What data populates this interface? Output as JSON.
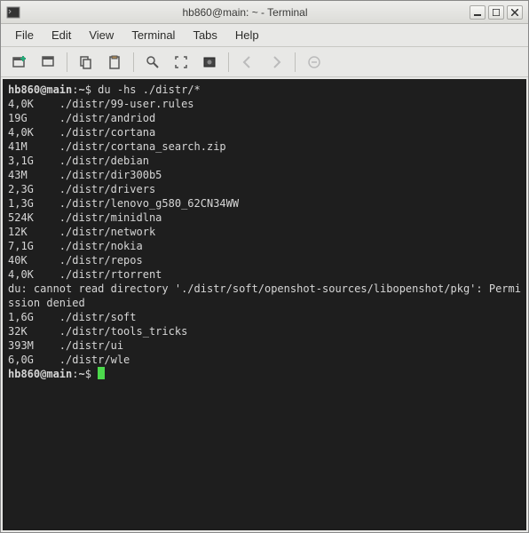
{
  "titlebar": {
    "title": "hb860@main: ~ - Terminal"
  },
  "menubar": {
    "file": "File",
    "edit": "Edit",
    "view": "View",
    "terminal": "Terminal",
    "tabs": "Tabs",
    "help": "Help"
  },
  "prompt": {
    "user_host": "hb860@main",
    "sep": ":",
    "path": "~",
    "symbol": "$"
  },
  "command": "du -hs ./distr/*",
  "output_rows": [
    {
      "size": "4,0K",
      "path": "./distr/99-user.rules"
    },
    {
      "size": "19G",
      "path": "./distr/andriod"
    },
    {
      "size": "4,0K",
      "path": "./distr/cortana"
    },
    {
      "size": "41M",
      "path": "./distr/cortana_search.zip"
    },
    {
      "size": "3,1G",
      "path": "./distr/debian"
    },
    {
      "size": "43M",
      "path": "./distr/dir300b5"
    },
    {
      "size": "2,3G",
      "path": "./distr/drivers"
    },
    {
      "size": "1,3G",
      "path": "./distr/lenovo_g580_62CN34WW"
    },
    {
      "size": "524K",
      "path": "./distr/minidlna"
    },
    {
      "size": "12K",
      "path": "./distr/network"
    },
    {
      "size": "7,1G",
      "path": "./distr/nokia"
    },
    {
      "size": "40K",
      "path": "./distr/repos"
    },
    {
      "size": "4,0K",
      "path": "./distr/rtorrent"
    }
  ],
  "error_line1": "du: cannot read directory './distr/soft/openshot-sources/libopenshot/pkg': Permi",
  "error_line2": "ssion denied",
  "output_rows2": [
    {
      "size": "1,6G",
      "path": "./distr/soft"
    },
    {
      "size": "32K",
      "path": "./distr/tools_tricks"
    },
    {
      "size": "393M",
      "path": "./distr/ui"
    },
    {
      "size": "6,0G",
      "path": "./distr/wle"
    }
  ]
}
